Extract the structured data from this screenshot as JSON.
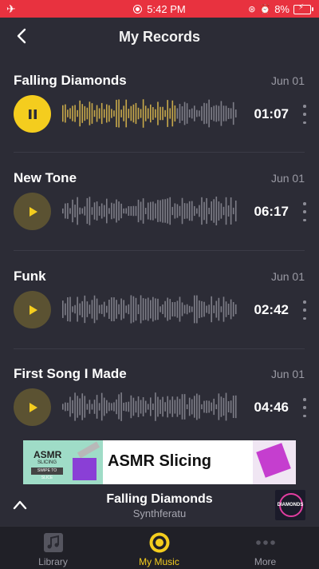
{
  "status_bar": {
    "time": "5:42 PM",
    "battery": "8%"
  },
  "header": {
    "title": "My Records"
  },
  "records": [
    {
      "title": "Falling Diamonds",
      "date": "Jun 01",
      "duration": "01:07",
      "state": "playing"
    },
    {
      "title": "New Tone",
      "date": "Jun 01",
      "duration": "06:17",
      "state": "paused"
    },
    {
      "title": "Funk",
      "date": "Jun 01",
      "duration": "02:42",
      "state": "paused"
    },
    {
      "title": "First Song I Made",
      "date": "Jun 01",
      "duration": "04:46",
      "state": "paused"
    }
  ],
  "ad": {
    "thumb_title": "ASMR",
    "thumb_subtitle": "SLICING",
    "thumb_tag": "SWIPE TO SLICE",
    "title": "ASMR Slicing"
  },
  "now_playing": {
    "title": "Falling Diamonds",
    "artist": "Synthferatu",
    "album_label": "DIAMONDS"
  },
  "tabs": [
    {
      "label": "Library",
      "icon": "music-note-icon",
      "active": false
    },
    {
      "label": "My Music",
      "icon": "disc-icon",
      "active": true
    },
    {
      "label": "More",
      "icon": "more-dots-icon",
      "active": false
    }
  ],
  "colors": {
    "accent": "#f4cd1e",
    "status_bar": "#e8323f",
    "background": "#2c2c36",
    "tab_bar": "#202027"
  }
}
